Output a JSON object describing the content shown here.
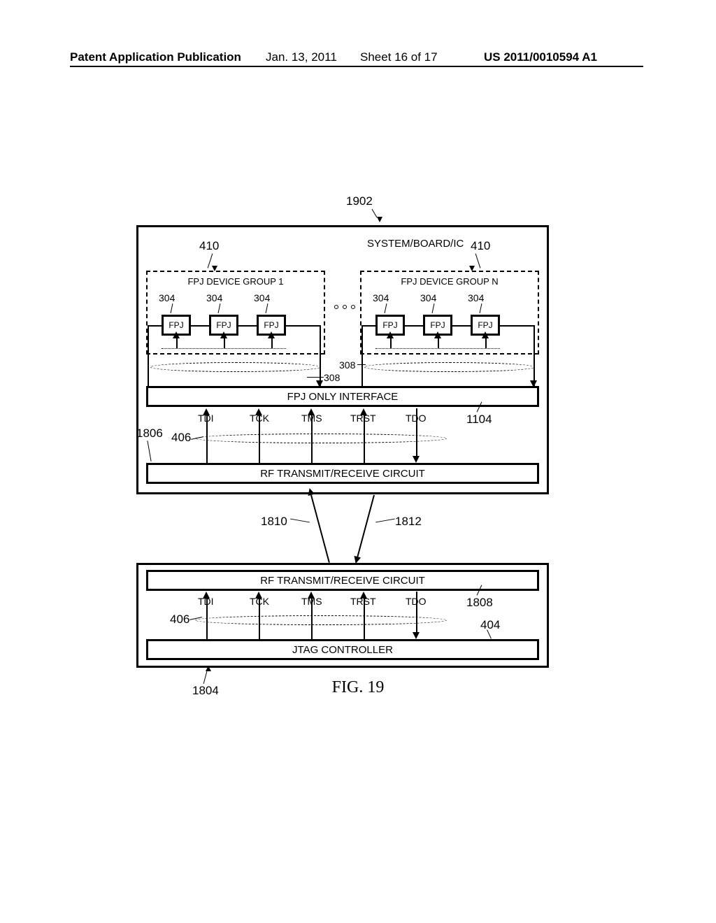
{
  "header": {
    "left": "Patent Application Publication",
    "date": "Jan. 13, 2011",
    "sheet": "Sheet 16 of 17",
    "pubno": "US 2011/0010594 A1"
  },
  "refs": {
    "r1902": "1902",
    "r410a": "410",
    "r410b": "410",
    "r304a": "304",
    "r304b": "304",
    "r304c": "304",
    "r304d": "304",
    "r304e": "304",
    "r304f": "304",
    "r308a": "308",
    "r308b": "308",
    "r1104": "1104",
    "r406a": "406",
    "r406b": "406",
    "r1806": "1806",
    "r1810": "1810",
    "r1812": "1812",
    "r1808": "1808",
    "r404": "404",
    "r1804": "1804"
  },
  "labels": {
    "systemboard": "SYSTEM/BOARD/IC",
    "grp1": "FPJ DEVICE GROUP 1",
    "grpn": "FPJ DEVICE GROUP N",
    "fpj": "FPJ",
    "fpjonly": "FPJ ONLY INTERFACE",
    "rf": "RF TRANSMIT/RECEIVE CIRCUIT",
    "jtagc": "JTAG CONTROLLER",
    "tdi": "TDI",
    "tck": "TCK",
    "tms": "TMS",
    "trst": "TRST",
    "tdo": "TDO"
  },
  "figure": {
    "caption": "FIG. 19"
  }
}
